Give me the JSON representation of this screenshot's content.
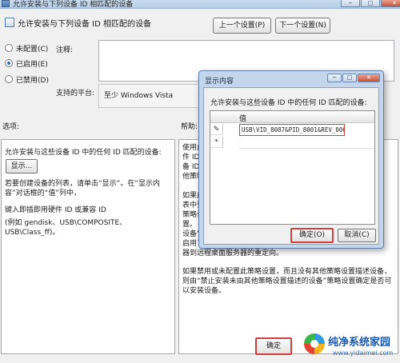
{
  "window": {
    "title": "允许安装与下列设备 ID 相匹配的设备",
    "controls": {
      "minimize": "─",
      "maximize": "□",
      "close": "✕"
    }
  },
  "header": {
    "title": "允许安装与下列设备 ID 相匹配的设备",
    "prev_label": "上一个设置(P)",
    "next_label": "下一个设置(N)"
  },
  "state": {
    "options": [
      {
        "label": "未配置(C)",
        "selected": false
      },
      {
        "label": "已启用(E)",
        "selected": true
      },
      {
        "label": "已禁用(D)",
        "selected": false
      }
    ],
    "comment_label": "注释:",
    "platform_label": "支持的平台:",
    "platform_value": "至少 Windows Vista"
  },
  "options_panel": {
    "label": "选项:",
    "description": "允许安装与这些设备 ID 中的任何 ID 匹配的设备:",
    "show_button": "显示...",
    "hint": "若要创建设备的列表，请单击“显示”。在“显示内容”对话框的“值”列中，",
    "enter_id": "键入即插即用硬件 ID 或兼容 ID",
    "example": "(例如 gendisk、USB\\COMPOSITE、USB\\Class_ff)。"
  },
  "help_panel": {
    "label": "帮助:",
    "lines": [
      "使用此",
      "件 ID",
      "备 ID",
      "他策略",
      "",
      "如果启",
      "表中列",
      "策略设",
      "置。",
      "设备”",
      "启用了",
      "器到远程桌面服务器的重定向。"
    ],
    "paragraph2": "如果禁用或未配置此策略设置，而且没有其他策略设置描述设备，则由“禁止安装未由其他策略设置描述的设备”策略设置确定是否可以安装设备。"
  },
  "footer": {
    "ok_label": "确定"
  },
  "dialog": {
    "title": "显示内容",
    "controls": {
      "minimize": "─",
      "maximize": "□",
      "close": "✕"
    },
    "description": "允许安装与这些设备 ID 中的任何 ID 匹配的设备:",
    "column_header": "值",
    "rows": [
      {
        "marker": "✎",
        "value": "USB\\VID_8087&PID_8001&REV_0000"
      },
      {
        "marker": "*",
        "value": ""
      }
    ],
    "ok_label": "确定(O)",
    "cancel_label": "取消(C)"
  },
  "watermark": {
    "title": "纯净系统家园",
    "url": "www.yidaimei.com"
  }
}
